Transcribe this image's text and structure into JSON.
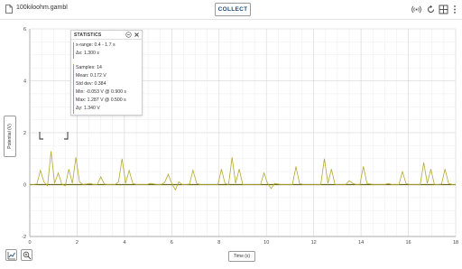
{
  "app": {
    "filename": "100kiloohm.gambl",
    "collect_label": "COLLECT"
  },
  "toolbar_icons": [
    "wireless-icon",
    "reset-icon",
    "layout-icon",
    "more-icon"
  ],
  "colors": {
    "series": "#b5a830",
    "series_dark": "#6b6b1a",
    "accent": "#1a4d7a"
  },
  "axes": {
    "ylabel": "Potential (V)",
    "xlabel": "Time (s)"
  },
  "chart_data": {
    "type": "line",
    "xlim": [
      0,
      18
    ],
    "ylim": [
      -2,
      6
    ],
    "xticks": [
      0,
      2,
      4,
      6,
      8,
      10,
      12,
      14,
      16,
      18
    ],
    "yticks": [
      -2,
      0,
      2,
      4,
      6
    ],
    "grid": true,
    "series": [
      {
        "x": [
          0,
          0.15,
          0.3,
          0.45,
          0.6,
          0.75,
          0.9,
          1.05,
          1.2,
          1.35,
          1.5,
          1.65,
          1.8,
          1.95,
          2.1,
          2.25,
          2.4,
          2.55,
          2.7,
          2.85,
          3.0,
          3.15,
          3.3,
          3.45,
          3.6,
          3.75,
          3.9,
          4.05,
          4.2,
          4.35,
          4.5,
          4.65,
          4.8,
          4.95,
          5.1,
          5.25,
          5.4,
          5.55,
          5.7,
          5.85,
          6.0,
          6.15,
          6.3,
          6.45,
          6.6,
          6.75,
          6.9,
          7.05,
          7.2,
          7.35,
          7.5,
          7.65,
          7.8,
          7.95,
          8.1,
          8.25,
          8.4,
          8.55,
          8.7,
          8.85,
          9.0,
          9.15,
          9.3,
          9.45,
          9.6,
          9.75,
          9.9,
          10.05,
          10.2,
          10.35,
          10.5,
          10.65,
          10.8,
          10.95,
          11.1,
          11.25,
          11.4,
          11.55,
          11.7,
          11.85,
          12.0,
          12.15,
          12.3,
          12.45,
          12.6,
          12.75,
          12.9,
          13.05,
          13.2,
          13.35,
          13.5,
          13.65,
          13.8,
          13.95,
          14.1,
          14.25,
          14.4,
          14.55,
          14.7,
          14.85,
          15.0,
          15.15,
          15.3,
          15.45,
          15.6,
          15.75,
          15.9,
          16.05,
          16.2,
          16.35,
          16.5,
          16.65,
          16.8,
          16.95,
          17.1,
          17.25,
          17.4,
          17.55,
          17.7,
          17.85,
          18.0
        ],
        "values": [
          0,
          0,
          0.02,
          0.55,
          0.1,
          -0.05,
          1.29,
          0.05,
          0.45,
          0.02,
          -0.05,
          0.6,
          0.05,
          1.05,
          0.1,
          0.0,
          0.02,
          0.05,
          0,
          0,
          0.3,
          0.02,
          0,
          0,
          0,
          0.1,
          1.0,
          0.05,
          0.55,
          0.05,
          0.0,
          0,
          0,
          0,
          0.05,
          0.02,
          0,
          0,
          0.08,
          0.4,
          0.05,
          -0.2,
          0.1,
          0,
          0,
          0.02,
          0.55,
          0.05,
          0.0,
          0,
          0,
          0,
          0,
          0,
          0.6,
          0.05,
          0,
          1.05,
          0.05,
          0.6,
          0,
          0,
          0,
          0,
          0,
          0,
          0.45,
          0.05,
          -0.15,
          0.05,
          0.02,
          0,
          0,
          0,
          0,
          0.7,
          0.05,
          0,
          0,
          0,
          0,
          0,
          0,
          1.0,
          0.05,
          0.6,
          0,
          0,
          0,
          0,
          0.15,
          0.05,
          0,
          0,
          0.7,
          0.05,
          0.02,
          0,
          0,
          0,
          0,
          0.05,
          0,
          0,
          0,
          0.5,
          0.05,
          0,
          0,
          0,
          0,
          0.85,
          0.05,
          0.6,
          0,
          0,
          0.02,
          0.6,
          0.05,
          0,
          0
        ]
      }
    ]
  },
  "statistics": {
    "title": "STATISTICS",
    "x_range": "x-range: 0.4 - 1.7 s",
    "dx": "Δx: 1.300 s",
    "samples": "Samples: 14",
    "mean": "Mean: 0.172 V",
    "std": "Std dev: 0.384",
    "min": "Min: -0.053 V @ 0.900 s",
    "max": "Max: 1.287 V @ 0.500 s",
    "dy": "Δy: 1.340 V"
  }
}
